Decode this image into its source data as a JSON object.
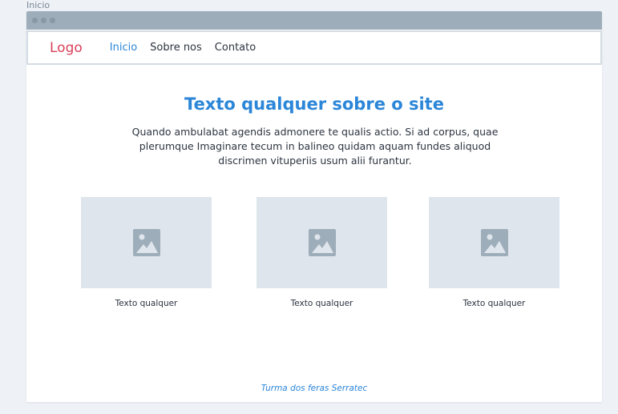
{
  "page_label": "Inicio",
  "nav": {
    "logo": "Logo",
    "items": [
      {
        "label": "Inicio",
        "active": true
      },
      {
        "label": "Sobre nos"
      },
      {
        "label": "Contato"
      }
    ]
  },
  "hero": {
    "title": "Texto qualquer sobre o site",
    "description": "Quando ambulabat agendis admonere te qualis actio. Si ad corpus, quae plerumque Imaginare tecum in balineo quidam aquam fundes aliquod discrimen vituperiis usum alii furantur."
  },
  "cards": [
    {
      "caption": "Texto qualquer",
      "icon": "image-icon"
    },
    {
      "caption": "Texto qualquer",
      "icon": "image-icon"
    },
    {
      "caption": "Texto qualquer",
      "icon": "image-icon"
    }
  ],
  "footer": {
    "text": "Turma dos feras Serratec"
  }
}
